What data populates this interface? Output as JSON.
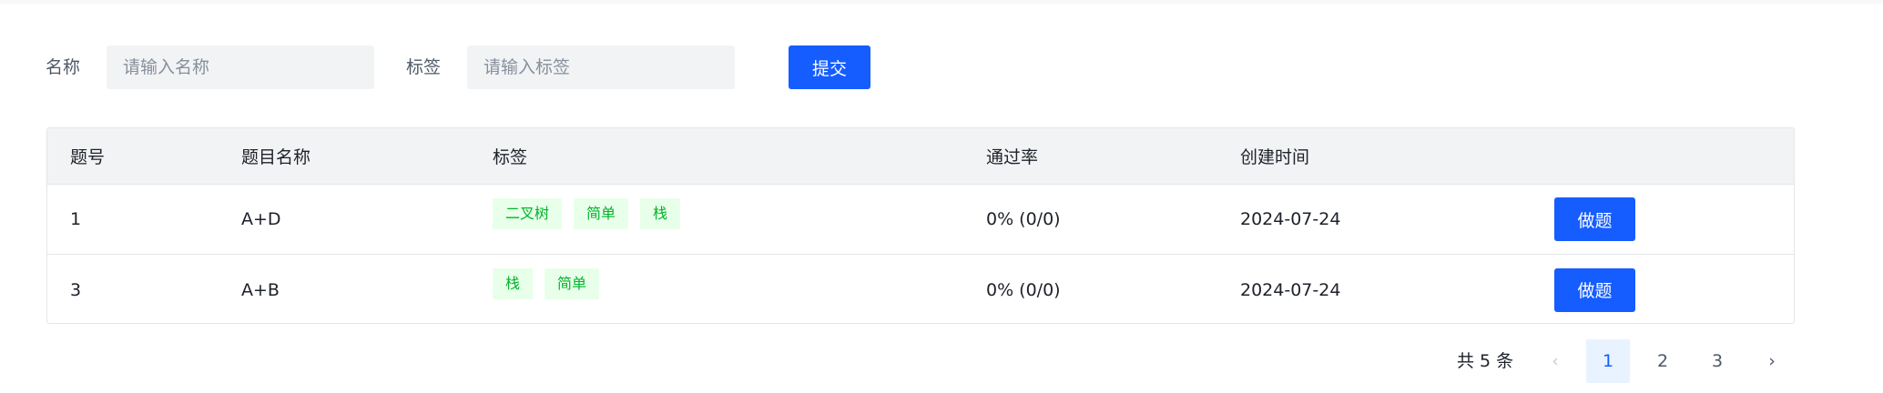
{
  "search": {
    "name_label": "名称",
    "name_placeholder": "请输入名称",
    "tag_label": "标签",
    "tag_placeholder": "请输入标签",
    "submit_label": "提交"
  },
  "table": {
    "headers": [
      "题号",
      "题目名称",
      "标签",
      "通过率",
      "创建时间"
    ],
    "rows": [
      {
        "id": "1",
        "name": "A+D",
        "tags": [
          "二叉树",
          "简单",
          "栈"
        ],
        "pass_rate": "0% (0/0)",
        "created": "2024-07-24",
        "action": "做题"
      },
      {
        "id": "3",
        "name": "A+B",
        "tags": [
          "栈",
          "简单"
        ],
        "pass_rate": "0% (0/0)",
        "created": "2024-07-24",
        "action": "做题"
      }
    ]
  },
  "pagination": {
    "total_text": "共 5 条",
    "pages": [
      "1",
      "2",
      "3"
    ],
    "current": "1",
    "prev_icon": "chevron-left",
    "next_icon": "chevron-right"
  },
  "colors": {
    "primary": "#165dff",
    "tag_bg": "#e8ffea",
    "tag_text": "#00b42a"
  }
}
